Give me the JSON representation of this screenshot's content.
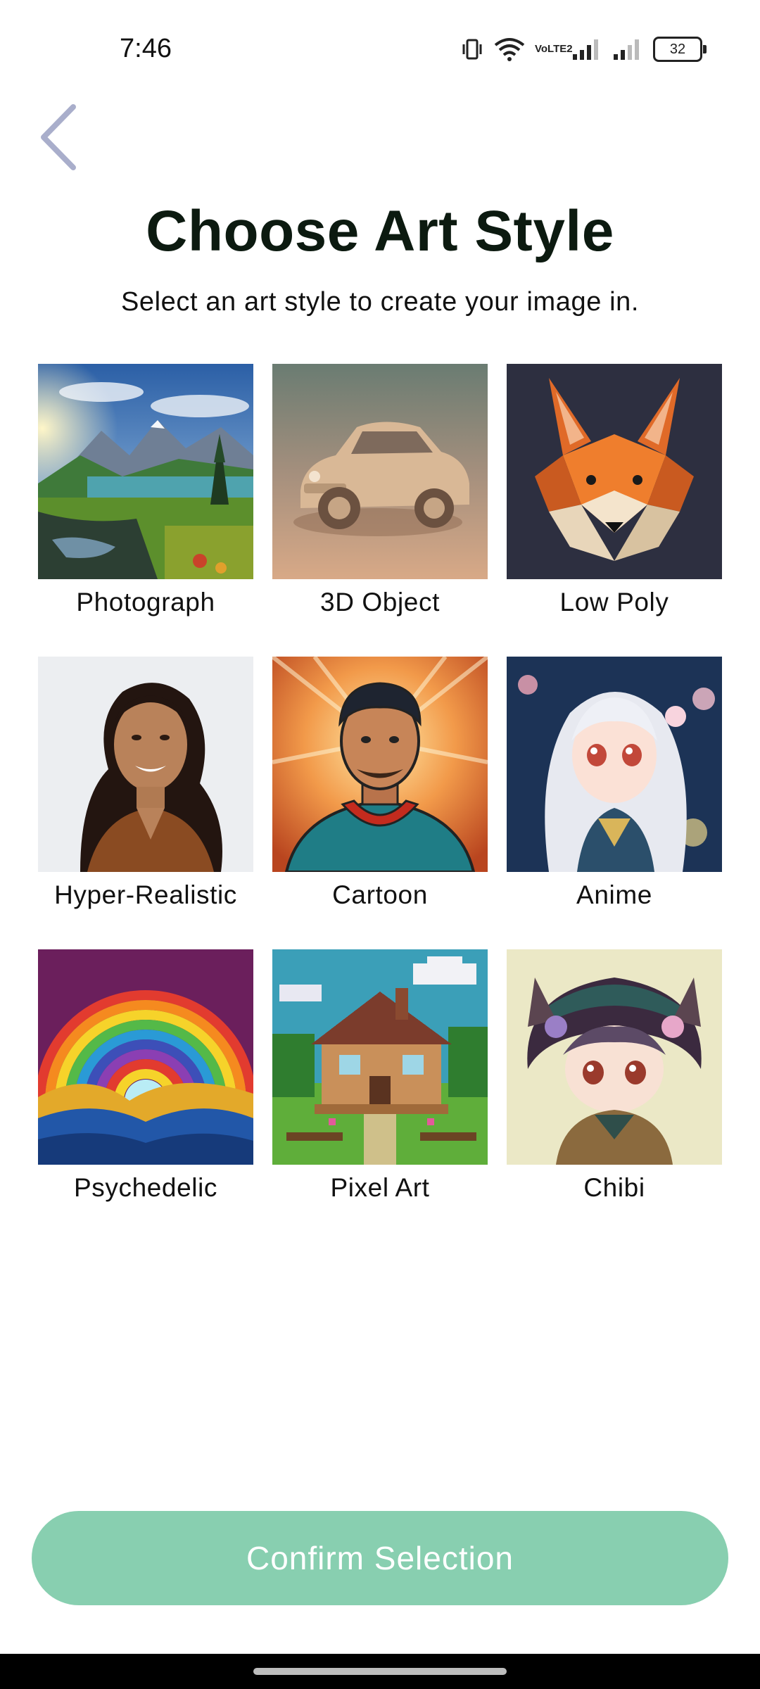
{
  "status_bar": {
    "time": "7:46",
    "battery": "32",
    "network_label": "VoLTE2",
    "icons": [
      "vibrate-icon",
      "wifi-icon",
      "volte-icon",
      "signal-icon",
      "signal-icon",
      "battery-icon"
    ]
  },
  "header": {
    "back_icon": "chevron-left-icon",
    "title": "Choose Art Style",
    "subtitle": "Select an art style to create your image in."
  },
  "styles": [
    {
      "label": "Photograph"
    },
    {
      "label": "3D Object"
    },
    {
      "label": "Low Poly"
    },
    {
      "label": "Hyper-Realistic"
    },
    {
      "label": "Cartoon"
    },
    {
      "label": "Anime"
    },
    {
      "label": "Psychedelic"
    },
    {
      "label": "Pixel Art"
    },
    {
      "label": "Chibi"
    }
  ],
  "footer": {
    "confirm_label": "Confirm Selection"
  },
  "colors": {
    "accent": "#88cfb0",
    "title": "#0c1a10",
    "back_icon": "#a9aecb"
  }
}
